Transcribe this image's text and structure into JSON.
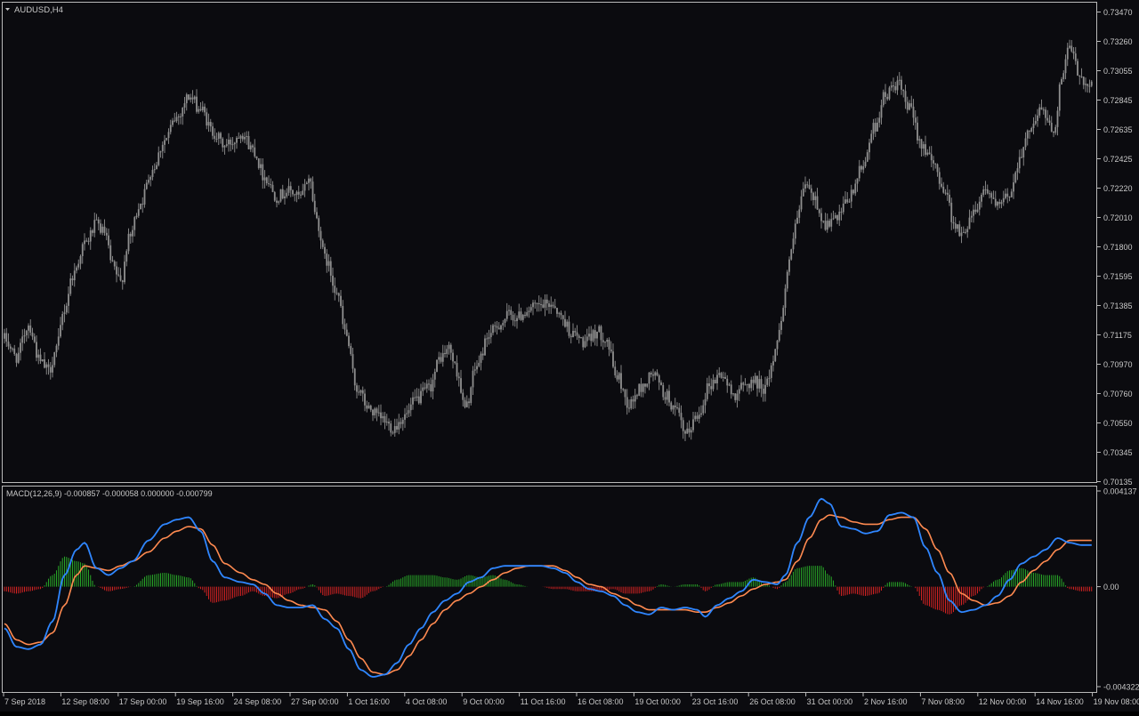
{
  "window": {
    "symbol_title": "AUDUSD,H4"
  },
  "icons": {
    "menu_caret": "triangle-down-icon"
  },
  "colors": {
    "background": "#0b0b0f",
    "frame": "#b9b9b9",
    "text": "#c8c8c8",
    "candle": "#8f8f8f",
    "macd_main": "#2f86ff",
    "macd_signal": "#ff8a50",
    "hist_positive": "#27a427",
    "hist_negative": "#d32222"
  },
  "price_scale": {
    "labels": [
      "0.73470",
      "0.73260",
      "0.73055",
      "0.72845",
      "0.72635",
      "0.72425",
      "0.72220",
      "0.72010",
      "0.71800",
      "0.71595",
      "0.71385",
      "0.71175",
      "0.70970",
      "0.70760",
      "0.70550",
      "0.70345",
      "0.70135"
    ],
    "min": 0.70135,
    "max": 0.7347
  },
  "time_axis": {
    "labels": [
      "7 Sep 2018",
      "12 Sep 08:00",
      "17 Sep 00:00",
      "19 Sep 16:00",
      "24 Sep 08:00",
      "27 Sep 00:00",
      "1 Oct 16:00",
      "4 Oct 08:00",
      "9 Oct 00:00",
      "11 Oct 16:00",
      "16 Oct 08:00",
      "19 Oct 00:00",
      "23 Oct 16:00",
      "26 Oct 08:00",
      "31 Oct 00:00",
      "2 Nov 16:00",
      "7 Nov 08:00",
      "12 Nov 00:00",
      "14 Nov 16:00",
      "19 Nov 08:00"
    ]
  },
  "macd": {
    "label": "MACD(12,26,9) -0.000857 -0.000058 0.000000 -0.000799",
    "scale_labels": [
      "0.004137",
      "0.00",
      "-0.004322"
    ],
    "max": 0.004137,
    "min": -0.004322
  },
  "chart_data": {
    "type": "candlestick",
    "price_anchors": [
      [
        0,
        0.7115
      ],
      [
        6,
        0.7102
      ],
      [
        12,
        0.7125
      ],
      [
        18,
        0.7098
      ],
      [
        22,
        0.7092
      ],
      [
        26,
        0.7108
      ],
      [
        30,
        0.7136
      ],
      [
        34,
        0.716
      ],
      [
        40,
        0.7182
      ],
      [
        46,
        0.7196
      ],
      [
        50,
        0.719
      ],
      [
        54,
        0.7166
      ],
      [
        58,
        0.7155
      ],
      [
        62,
        0.7185
      ],
      [
        68,
        0.7212
      ],
      [
        74,
        0.7236
      ],
      [
        80,
        0.7256
      ],
      [
        86,
        0.7272
      ],
      [
        92,
        0.7287
      ],
      [
        98,
        0.7278
      ],
      [
        104,
        0.7262
      ],
      [
        110,
        0.7252
      ],
      [
        114,
        0.7255
      ],
      [
        118,
        0.7262
      ],
      [
        124,
        0.725
      ],
      [
        130,
        0.723
      ],
      [
        136,
        0.7216
      ],
      [
        142,
        0.722
      ],
      [
        148,
        0.7215
      ],
      [
        152,
        0.723
      ],
      [
        156,
        0.72
      ],
      [
        160,
        0.7172
      ],
      [
        166,
        0.715
      ],
      [
        170,
        0.712
      ],
      [
        176,
        0.708
      ],
      [
        182,
        0.7065
      ],
      [
        188,
        0.7058
      ],
      [
        194,
        0.7052
      ],
      [
        200,
        0.706
      ],
      [
        206,
        0.7072
      ],
      [
        212,
        0.708
      ],
      [
        218,
        0.7102
      ],
      [
        222,
        0.7108
      ],
      [
        226,
        0.7092
      ],
      [
        230,
        0.7065
      ],
      [
        236,
        0.7096
      ],
      [
        242,
        0.7118
      ],
      [
        248,
        0.7126
      ],
      [
        252,
        0.7132
      ],
      [
        256,
        0.713
      ],
      [
        262,
        0.7136
      ],
      [
        268,
        0.7138
      ],
      [
        274,
        0.714
      ],
      [
        278,
        0.713
      ],
      [
        284,
        0.7118
      ],
      [
        290,
        0.7112
      ],
      [
        296,
        0.712
      ],
      [
        300,
        0.7116
      ],
      [
        306,
        0.7088
      ],
      [
        312,
        0.7068
      ],
      [
        318,
        0.708
      ],
      [
        324,
        0.709
      ],
      [
        330,
        0.7075
      ],
      [
        336,
        0.7062
      ],
      [
        340,
        0.7046
      ],
      [
        346,
        0.706
      ],
      [
        352,
        0.7082
      ],
      [
        358,
        0.709
      ],
      [
        364,
        0.7075
      ],
      [
        368,
        0.708
      ],
      [
        374,
        0.7085
      ],
      [
        380,
        0.708
      ],
      [
        384,
        0.71
      ],
      [
        388,
        0.713
      ],
      [
        392,
        0.717
      ],
      [
        396,
        0.72
      ],
      [
        400,
        0.7225
      ],
      [
        404,
        0.7215
      ],
      [
        410,
        0.7196
      ],
      [
        416,
        0.72
      ],
      [
        422,
        0.7215
      ],
      [
        428,
        0.7235
      ],
      [
        434,
        0.7264
      ],
      [
        440,
        0.7288
      ],
      [
        446,
        0.7296
      ],
      [
        452,
        0.7278
      ],
      [
        458,
        0.7254
      ],
      [
        464,
        0.7238
      ],
      [
        470,
        0.722
      ],
      [
        474,
        0.7198
      ],
      [
        478,
        0.7188
      ],
      [
        484,
        0.7206
      ],
      [
        490,
        0.7222
      ],
      [
        496,
        0.7208
      ],
      [
        502,
        0.7218
      ],
      [
        508,
        0.7248
      ],
      [
        514,
        0.727
      ],
      [
        518,
        0.7278
      ],
      [
        524,
        0.7262
      ],
      [
        528,
        0.73
      ],
      [
        532,
        0.7322
      ],
      [
        536,
        0.7306
      ],
      [
        540,
        0.7296
      ]
    ],
    "macd_main_anchors": [
      [
        0,
        -0.0018
      ],
      [
        6,
        -0.0026
      ],
      [
        12,
        -0.0027
      ],
      [
        18,
        -0.0025
      ],
      [
        24,
        -0.0015
      ],
      [
        30,
        0.0005
      ],
      [
        36,
        0.0016
      ],
      [
        40,
        0.0019
      ],
      [
        46,
        0.0008
      ],
      [
        52,
        0.0005
      ],
      [
        58,
        0.0008
      ],
      [
        64,
        0.0011
      ],
      [
        72,
        0.002
      ],
      [
        80,
        0.0027
      ],
      [
        86,
        0.0029
      ],
      [
        92,
        0.003
      ],
      [
        98,
        0.0024
      ],
      [
        104,
        0.0011
      ],
      [
        110,
        0.0004
      ],
      [
        118,
        0.0002
      ],
      [
        124,
        0.0001
      ],
      [
        130,
        -0.0003
      ],
      [
        136,
        -0.0008
      ],
      [
        142,
        -0.0009
      ],
      [
        148,
        -0.0009
      ],
      [
        154,
        -0.0008
      ],
      [
        160,
        -0.0014
      ],
      [
        166,
        -0.0018
      ],
      [
        172,
        -0.0027
      ],
      [
        178,
        -0.0036
      ],
      [
        184,
        -0.0039
      ],
      [
        190,
        -0.0038
      ],
      [
        196,
        -0.0033
      ],
      [
        202,
        -0.0025
      ],
      [
        208,
        -0.0018
      ],
      [
        214,
        -0.0011
      ],
      [
        220,
        -0.0006
      ],
      [
        226,
        -0.0003
      ],
      [
        232,
        0.0002
      ],
      [
        238,
        0.0004
      ],
      [
        244,
        0.0008
      ],
      [
        250,
        0.0009
      ],
      [
        256,
        0.0009
      ],
      [
        262,
        0.0009
      ],
      [
        268,
        0.0009
      ],
      [
        274,
        0.0008
      ],
      [
        280,
        0.0006
      ],
      [
        286,
        0.0002
      ],
      [
        292,
        -0.0001
      ],
      [
        298,
        -0.0002
      ],
      [
        304,
        -0.0004
      ],
      [
        310,
        -0.0008
      ],
      [
        316,
        -0.0011
      ],
      [
        322,
        -0.0012
      ],
      [
        328,
        -0.0009
      ],
      [
        334,
        -0.001
      ],
      [
        340,
        -0.0009
      ],
      [
        346,
        -0.001
      ],
      [
        350,
        -0.0013
      ],
      [
        356,
        -0.0008
      ],
      [
        362,
        -0.0005
      ],
      [
        368,
        -0.0002
      ],
      [
        374,
        0.0003
      ],
      [
        380,
        0.0002
      ],
      [
        386,
        0.0001
      ],
      [
        390,
        0.0005
      ],
      [
        396,
        0.0019
      ],
      [
        402,
        0.003
      ],
      [
        408,
        0.0038
      ],
      [
        412,
        0.0036
      ],
      [
        418,
        0.0026
      ],
      [
        424,
        0.0025
      ],
      [
        430,
        0.0023
      ],
      [
        436,
        0.0024
      ],
      [
        442,
        0.0031
      ],
      [
        448,
        0.0032
      ],
      [
        454,
        0.003
      ],
      [
        460,
        0.0017
      ],
      [
        466,
        0.0006
      ],
      [
        472,
        -0.0006
      ],
      [
        478,
        -0.0011
      ],
      [
        484,
        -0.001
      ],
      [
        490,
        -0.0008
      ],
      [
        496,
        -0.0004
      ],
      [
        502,
        0.0003
      ],
      [
        508,
        0.001
      ],
      [
        514,
        0.0013
      ],
      [
        520,
        0.0016
      ],
      [
        526,
        0.0021
      ],
      [
        532,
        0.0019
      ],
      [
        538,
        0.0018
      ]
    ],
    "macd_signal_anchors": [
      [
        0,
        -0.0016
      ],
      [
        6,
        -0.0023
      ],
      [
        12,
        -0.0025
      ],
      [
        18,
        -0.0024
      ],
      [
        24,
        -0.002
      ],
      [
        30,
        -0.0008
      ],
      [
        36,
        0.0005
      ],
      [
        40,
        0.0009
      ],
      [
        46,
        0.0008
      ],
      [
        52,
        0.0007
      ],
      [
        58,
        0.0009
      ],
      [
        64,
        0.0011
      ],
      [
        72,
        0.0015
      ],
      [
        80,
        0.0021
      ],
      [
        86,
        0.0024
      ],
      [
        92,
        0.0026
      ],
      [
        98,
        0.0025
      ],
      [
        104,
        0.0018
      ],
      [
        110,
        0.001
      ],
      [
        118,
        0.0006
      ],
      [
        124,
        0.0003
      ],
      [
        130,
        0.0001
      ],
      [
        136,
        -0.0003
      ],
      [
        142,
        -0.0006
      ],
      [
        148,
        -0.0008
      ],
      [
        154,
        -0.0009
      ],
      [
        160,
        -0.001
      ],
      [
        166,
        -0.0015
      ],
      [
        172,
        -0.0023
      ],
      [
        178,
        -0.0031
      ],
      [
        184,
        -0.0037
      ],
      [
        190,
        -0.0038
      ],
      [
        196,
        -0.0036
      ],
      [
        202,
        -0.003
      ],
      [
        208,
        -0.0023
      ],
      [
        214,
        -0.0016
      ],
      [
        220,
        -0.001
      ],
      [
        226,
        -0.0006
      ],
      [
        232,
        -0.0003
      ],
      [
        238,
        0.0
      ],
      [
        244,
        0.0003
      ],
      [
        250,
        0.0006
      ],
      [
        256,
        0.0008
      ],
      [
        262,
        0.0009
      ],
      [
        268,
        0.0009
      ],
      [
        274,
        0.0009
      ],
      [
        280,
        0.0007
      ],
      [
        286,
        0.0004
      ],
      [
        292,
        0.0001
      ],
      [
        298,
        -0.0
      ],
      [
        304,
        -0.0003
      ],
      [
        310,
        -0.0005
      ],
      [
        316,
        -0.0008
      ],
      [
        322,
        -0.001
      ],
      [
        328,
        -0.001
      ],
      [
        334,
        -0.001
      ],
      [
        340,
        -0.001
      ],
      [
        346,
        -0.0011
      ],
      [
        350,
        -0.0011
      ],
      [
        356,
        -0.0009
      ],
      [
        362,
        -0.0007
      ],
      [
        368,
        -0.0004
      ],
      [
        374,
        -0.0001
      ],
      [
        380,
        0.0001
      ],
      [
        386,
        0.0002
      ],
      [
        390,
        0.0003
      ],
      [
        396,
        0.0011
      ],
      [
        402,
        0.0021
      ],
      [
        408,
        0.0029
      ],
      [
        412,
        0.0031
      ],
      [
        418,
        0.003
      ],
      [
        424,
        0.0028
      ],
      [
        430,
        0.0027
      ],
      [
        436,
        0.0027
      ],
      [
        442,
        0.0029
      ],
      [
        448,
        0.003
      ],
      [
        454,
        0.003
      ],
      [
        460,
        0.0025
      ],
      [
        466,
        0.0016
      ],
      [
        472,
        0.0006
      ],
      [
        478,
        -0.0003
      ],
      [
        484,
        -0.0006
      ],
      [
        490,
        -0.0008
      ],
      [
        496,
        -0.0007
      ],
      [
        502,
        -0.0004
      ],
      [
        508,
        0.0002
      ],
      [
        514,
        0.0007
      ],
      [
        520,
        0.0011
      ],
      [
        526,
        0.0016
      ],
      [
        532,
        0.002
      ],
      [
        538,
        0.002
      ]
    ],
    "ylim": [
      0.70135,
      0.7347
    ],
    "macd_ylim": [
      -0.004322,
      0.004137
    ]
  }
}
